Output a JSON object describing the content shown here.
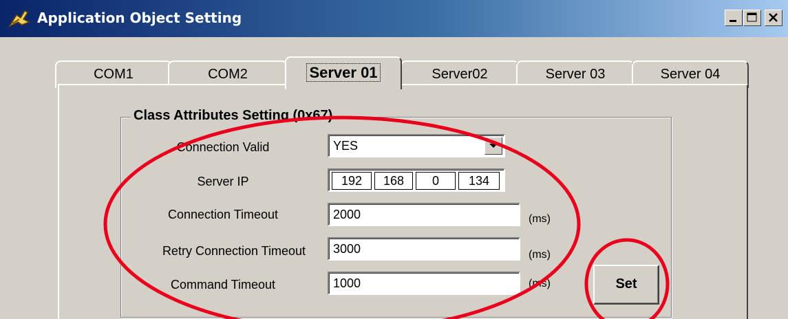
{
  "window": {
    "title": "Application Object Setting"
  },
  "tabs": [
    {
      "label": "COM1"
    },
    {
      "label": "COM2"
    },
    {
      "label": "Server 01",
      "active": true
    },
    {
      "label": "Server02"
    },
    {
      "label": "Server 03"
    },
    {
      "label": "Server 04"
    }
  ],
  "group": {
    "legend": "Class Attributes Setting (0x67)"
  },
  "form": {
    "connection_valid": {
      "label": "Connection Valid",
      "value": "YES"
    },
    "server_ip": {
      "label": "Server IP",
      "octets": [
        "192",
        "168",
        "0",
        "134"
      ]
    },
    "connection_timeout": {
      "label": "Connection Timeout",
      "value": "2000",
      "unit": "(ms)"
    },
    "retry_timeout": {
      "label": "Retry Connection Timeout",
      "value": "3000",
      "unit": "(ms)"
    },
    "command_timeout": {
      "label": "Command Timeout",
      "value": "1000",
      "unit": "(ms)"
    }
  },
  "buttons": {
    "set": "Set"
  },
  "annotation": {
    "color": "#e8001c"
  }
}
